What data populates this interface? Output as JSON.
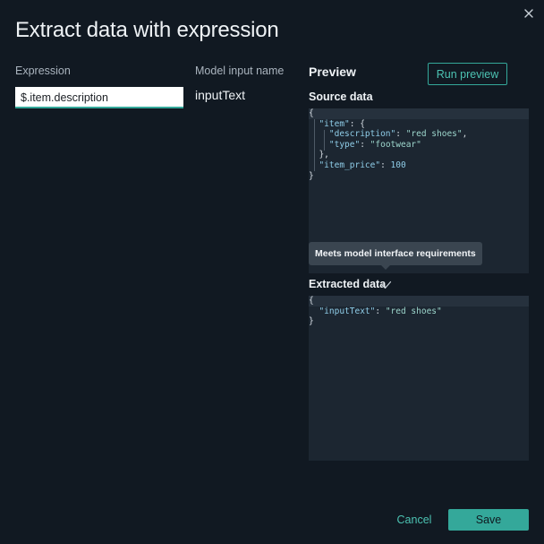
{
  "dialog": {
    "title": "Extract data with expression",
    "close_icon": "close-icon"
  },
  "columns": {
    "expression_label": "Expression",
    "model_input_name_label": "Model input name"
  },
  "expression": {
    "value": "$.item.description"
  },
  "model_input": {
    "name": "inputText"
  },
  "preview": {
    "heading": "Preview",
    "run_button_label": "Run preview",
    "source_data_label": "Source data",
    "source_json": [
      "{",
      "  \"item\": {",
      "    \"description\": \"red shoes\",",
      "    \"type\": \"footwear\"",
      "  },",
      "  \"item_price\": 100",
      "}"
    ],
    "tooltip": "Meets model interface requirements",
    "extracted_data_label": "Extracted data",
    "extracted_status_icon": "check-icon",
    "extracted_json": [
      "{",
      "  \"inputText\": \"red shoes\"",
      "}"
    ]
  },
  "footer": {
    "cancel_label": "Cancel",
    "save_label": "Save"
  },
  "colors": {
    "accent": "#34a89a",
    "background": "#111922",
    "code_panel": "#1c2631"
  }
}
